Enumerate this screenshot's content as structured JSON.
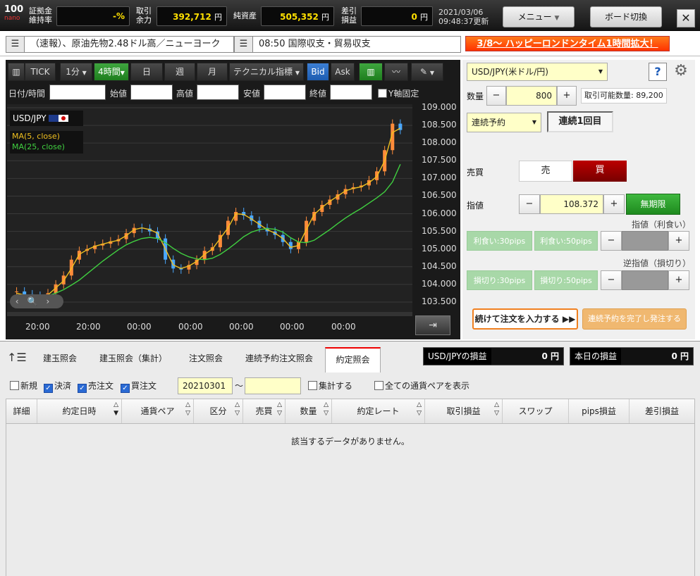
{
  "topbar": {
    "logo_main": "100",
    "logo_sub": "nano",
    "margin_label": "証拠金\n維持率",
    "margin_value": "-%",
    "available_label": "取引\n余力",
    "available_value": "392,712",
    "available_unit": "円",
    "net_assets_label": "純資産",
    "net_assets_value": "505,352",
    "net_assets_unit": "円",
    "pl_label": "差引\n損益",
    "pl_value": "0",
    "pl_unit": "円",
    "date": "2021/03/06",
    "updated": "09:48:37更新",
    "menu_label": "メニュー",
    "board_label": "ボード切換",
    "close_label": "✕"
  },
  "news": {
    "item1": "（速報）、原油先物2.48ドル高／ニューヨーク",
    "item2": "08:50 国際収支・貿易収支",
    "promo": "3/8～ ハッピーロンドンタイム1時間拡大！"
  },
  "chart_toolbar": {
    "tick": "TICK",
    "interval": "1分",
    "timeframe": "4時間",
    "day": "日",
    "week": "週",
    "month": "月",
    "indicators": "テクニカル指標",
    "bid": "Bid",
    "ask": "Ask"
  },
  "chart_fields": {
    "date": "日付/時間",
    "open": "始値",
    "high": "高値",
    "low": "安値",
    "close": "終値",
    "yfix": "Y軸固定"
  },
  "chart_legend": {
    "pair": "USD/JPY",
    "ma5": "MA(5, close)",
    "ma25": "MA(25, close)"
  },
  "chart_data": {
    "type": "line",
    "title": "USD/JPY",
    "xlabel": "",
    "ylabel": "",
    "ylim": [
      103.2,
      109.1
    ],
    "yticks": [
      "109.000",
      "108.500",
      "108.000",
      "107.500",
      "107.000",
      "106.500",
      "106.000",
      "105.500",
      "105.000",
      "104.500",
      "104.000",
      "103.500"
    ],
    "xticks": [
      "20:00",
      "20:00",
      "00:00",
      "00:00",
      "00:00",
      "00:00",
      "00:00"
    ],
    "series": [
      {
        "name": "MA(5, close)",
        "color": "#f0c020",
        "values": [
          103.75,
          103.7,
          103.7,
          103.66,
          103.7,
          103.9,
          104.1,
          104.45,
          104.85,
          104.98,
          105.08,
          105.14,
          105.2,
          105.25,
          105.38,
          105.55,
          105.6,
          105.55,
          105.45,
          105.0,
          104.55,
          104.45,
          104.52,
          104.65,
          104.85,
          105.0,
          105.3,
          105.6,
          106.0,
          105.98,
          105.85,
          105.7,
          105.55,
          105.45,
          105.3,
          105.05,
          105.1,
          105.55,
          105.98,
          106.18,
          106.35,
          106.5,
          106.65,
          106.72,
          106.76,
          106.88,
          107.05,
          107.5,
          108.3,
          108.42
        ]
      },
      {
        "name": "MA(25, close)",
        "color": "#40d040",
        "values": [
          103.68,
          103.68,
          103.67,
          103.67,
          103.68,
          103.75,
          103.85,
          103.98,
          104.12,
          104.3,
          104.48,
          104.66,
          104.82,
          104.98,
          105.12,
          105.22,
          105.3,
          105.33,
          105.3,
          105.18,
          105.02,
          104.88,
          104.78,
          104.72,
          104.7,
          104.74,
          104.85,
          105.0,
          105.17,
          105.35,
          105.48,
          105.55,
          105.58,
          105.56,
          105.48,
          105.32,
          105.2,
          105.18,
          105.25,
          105.4,
          105.55,
          105.72,
          105.88,
          106.02,
          106.15,
          106.3,
          106.45,
          106.62,
          106.9,
          107.4
        ]
      }
    ],
    "candles_close": [
      103.8,
      103.72,
      103.68,
      103.6,
      103.75,
      104.0,
      104.25,
      104.7,
      104.95,
      105.0,
      105.1,
      105.15,
      105.22,
      105.28,
      105.45,
      105.6,
      105.58,
      105.5,
      105.3,
      104.7,
      104.45,
      104.42,
      104.55,
      104.7,
      104.95,
      105.05,
      105.4,
      105.8,
      106.05,
      105.95,
      105.8,
      105.6,
      105.5,
      105.4,
      105.2,
      105.0,
      105.2,
      105.8,
      106.05,
      106.25,
      106.4,
      106.55,
      106.7,
      106.75,
      106.8,
      106.95,
      107.2,
      107.8,
      108.55,
      108.37
    ]
  },
  "order": {
    "pair": "USD/JPY(米ドル/円)",
    "help": "?",
    "qty_label": "数量",
    "qty_value": "800",
    "tradable_label": "取引可能数量:",
    "tradable_value": "89,200",
    "mode": "連続予約",
    "round": "連続1回目",
    "side_label": "売買",
    "sell": "売",
    "buy": "買",
    "price_label": "指値",
    "price_value": "108.372",
    "expiry": "無期限",
    "tp_label": "指値（利食い）",
    "tp30": "利食い:30pips",
    "tp50": "利食い:50pips",
    "sl_label": "逆指値（損切り）",
    "sl30": "損切り:30pips",
    "sl50": "損切り:50pips",
    "continue_btn": "続けて注文を入力する",
    "complete_btn": "連続予約を完了し発注する",
    "minus": "−",
    "plus": "+"
  },
  "bottom": {
    "tabs": [
      "建玉照会",
      "建玉照会（集計）",
      "注文照会",
      "連続予約注文照会",
      "約定照会"
    ],
    "pair_pl_label": "USD/JPYの損益",
    "pair_pl_value": "0 円",
    "today_pl_label": "本日の損益",
    "today_pl_value": "0 円",
    "filter_new": "新規",
    "filter_settle": "決済",
    "filter_sell": "売注文",
    "filter_buy": "買注文",
    "date_from": "20210301",
    "tilde": "～",
    "aggregate": "集計する",
    "all_pairs": "全ての通貨ペアを表示",
    "columns": [
      "詳細",
      "約定日時",
      "通貨ペア",
      "区分",
      "売買",
      "数量",
      "約定レート",
      "取引損益",
      "スワップ",
      "pips損益",
      "差引損益"
    ],
    "empty_message": "該当するデータがありません。"
  }
}
